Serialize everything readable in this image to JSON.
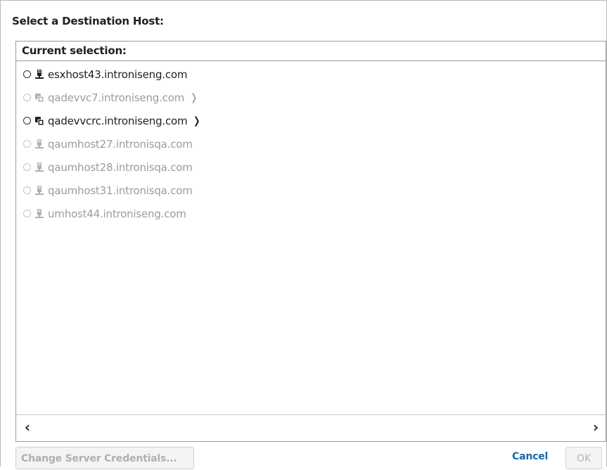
{
  "dialog": {
    "title": "Select a Destination Host:"
  },
  "host_panel": {
    "header": "Current selection:",
    "hosts": [
      {
        "name": "esxhost43.introniseng.com",
        "icon": "host-icon",
        "enabled": true,
        "expandable": false
      },
      {
        "name": "qadevvc7.introniseng.com",
        "icon": "vcenter-icon",
        "enabled": false,
        "expandable": true
      },
      {
        "name": "qadevvcrc.introniseng.com",
        "icon": "vcenter-icon",
        "enabled": true,
        "expandable": true
      },
      {
        "name": "qaumhost27.intronisqa.com",
        "icon": "host-icon",
        "enabled": false,
        "expandable": false
      },
      {
        "name": "qaumhost28.intronisqa.com",
        "icon": "host-icon",
        "enabled": false,
        "expandable": false
      },
      {
        "name": "qaumhost31.intronisqa.com",
        "icon": "host-icon",
        "enabled": false,
        "expandable": false
      },
      {
        "name": "umhost44.introniseng.com",
        "icon": "host-icon",
        "enabled": false,
        "expandable": false
      }
    ],
    "scroll_left": "‹",
    "scroll_right": "›"
  },
  "buttons": {
    "credentials": "Change Server Credentials...",
    "cancel": "Cancel",
    "ok": "OK"
  },
  "colors": {
    "accent_link": "#1a67a8",
    "disabled_text": "#9c9c9c",
    "enabled_text": "#1f1f1f"
  }
}
